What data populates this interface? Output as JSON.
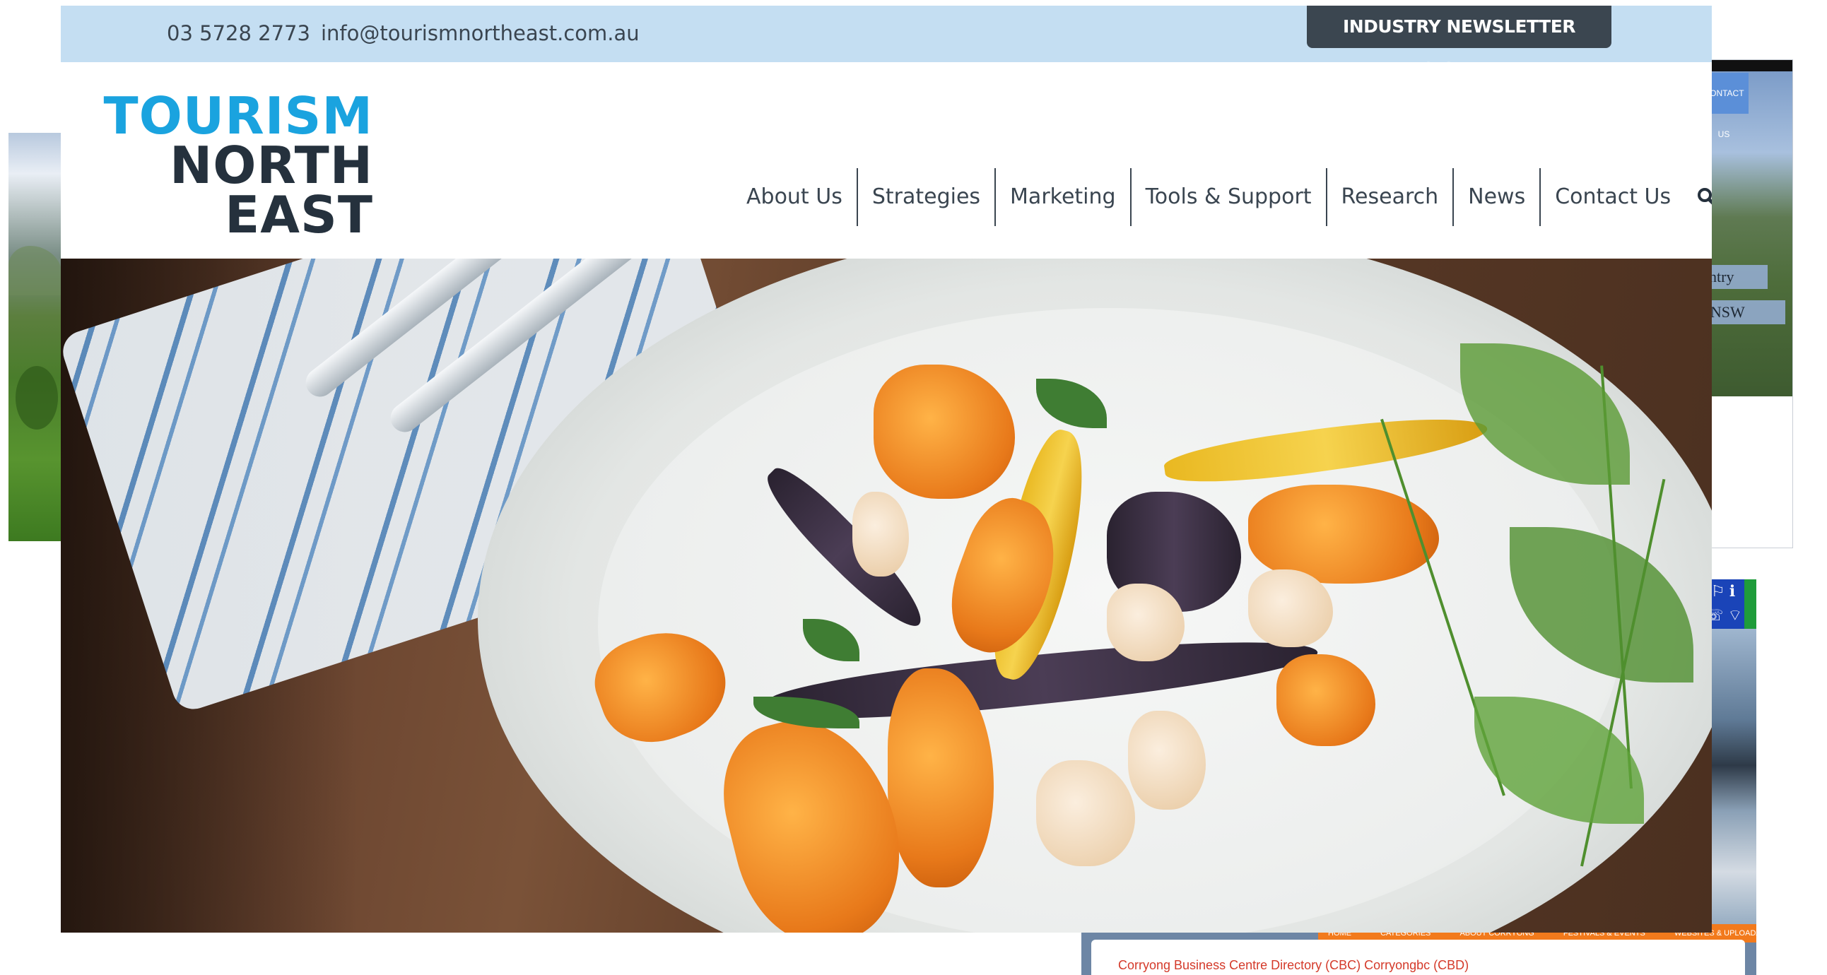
{
  "topbar": {
    "phone": "03 5728 2773",
    "email": "info@tourismnortheast.com.au",
    "signup_label": "INDUSTRY NEWSLETTER SIGNUP"
  },
  "logo": {
    "line1": "TOURISM",
    "line2": "NORTH",
    "line3": "EAST"
  },
  "nav": {
    "items": [
      "About Us",
      "Strategies",
      "Marketing",
      "Tools & Support",
      "Research",
      "News",
      "Contact Us"
    ]
  },
  "background_windows": {
    "right_window_1": {
      "contact_button": "CONTACT US",
      "label1": "ountry",
      "label2": "rn NSW"
    },
    "right_window_2": {
      "nav_items": [
        "HOME",
        "CATEGORIES",
        "ABOUT CORRYONG",
        "FESTIVALS & EVENTS",
        "WEBSITES & UPLOADATION"
      ],
      "directory_text": "Corryong Business Centre Directory (CBC) Corryongbc (CBD)"
    }
  },
  "colors": {
    "topbar_bg": "#c4def2",
    "signup_bg": "#3b4650",
    "logo_blue": "#1aa3df",
    "logo_dark": "#25313d",
    "nav_text": "#3a4550"
  },
  "icons": {
    "search": "search-icon"
  }
}
